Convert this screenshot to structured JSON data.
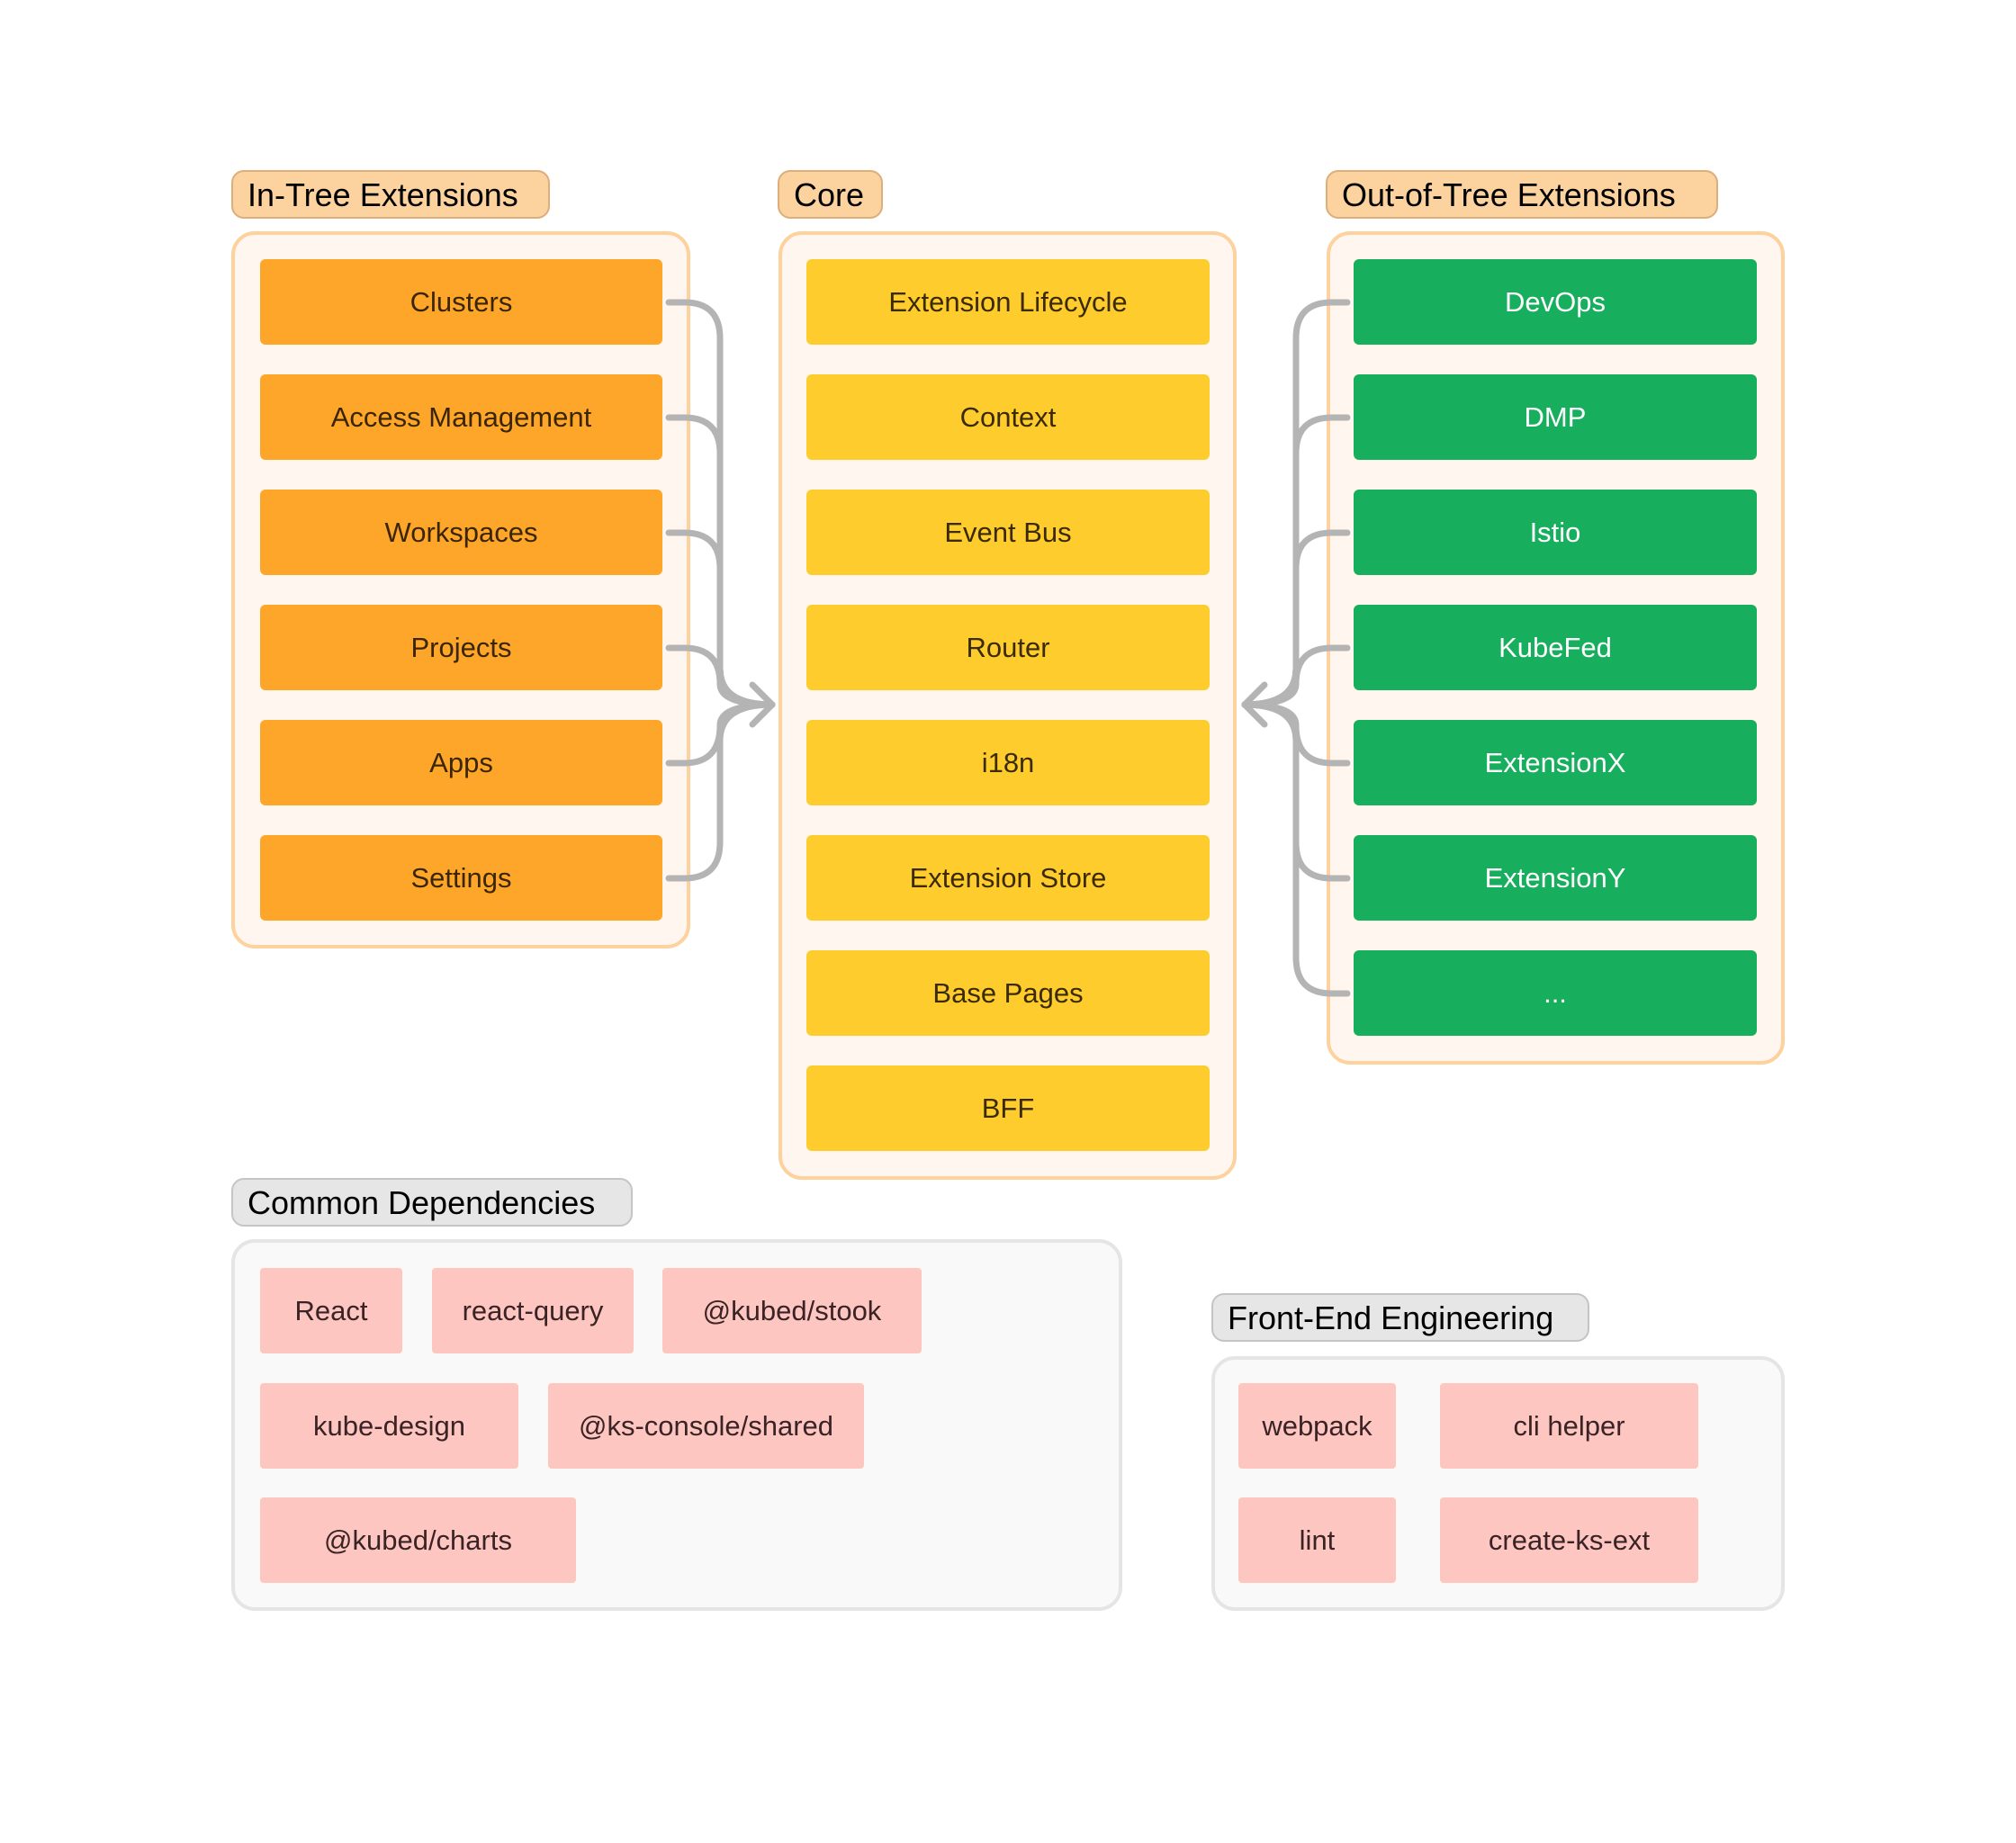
{
  "diagram": {
    "in_tree": {
      "title": "In-Tree Extensions",
      "items": [
        "Clusters",
        "Access Management",
        "Workspaces",
        "Projects",
        "Apps",
        "Settings"
      ],
      "color": "#fea62a"
    },
    "core": {
      "title": "Core",
      "items": [
        "Extension Lifecycle",
        "Context",
        "Event Bus",
        "Router",
        "i18n",
        "Extension Store",
        "Base Pages",
        "BFF"
      ],
      "color": "#fecc2d"
    },
    "out_of_tree": {
      "title": "Out-of-Tree Extensions",
      "items": [
        "DevOps",
        "DMP",
        "Istio",
        "KubeFed",
        "ExtensionX",
        "ExtensionY",
        "..."
      ],
      "color": "#17ae5d"
    },
    "common_dependencies": {
      "title": "Common Dependencies",
      "items": [
        "React",
        "react-query",
        "@kubed/stook",
        "kube-design",
        "@ks-console/shared",
        "@kubed/charts"
      ],
      "color": "#fec6c1"
    },
    "front_end_engineering": {
      "title": "Front-End Engineering",
      "items": [
        "webpack",
        "cli helper",
        "lint",
        "create-ks-ext"
      ],
      "color": "#fec6c1"
    },
    "connections": [
      {
        "from": "In-Tree Extensions",
        "to": "Core",
        "icon": "arrow-right-icon"
      },
      {
        "from": "Out-of-Tree Extensions",
        "to": "Core",
        "icon": "arrow-left-icon"
      }
    ]
  }
}
